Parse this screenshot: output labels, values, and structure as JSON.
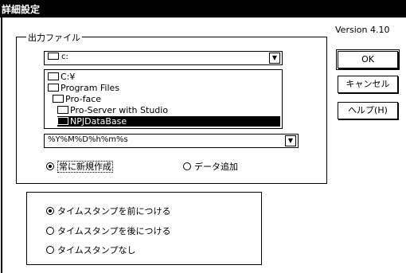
{
  "window": {
    "title": "詳細設定",
    "version": "Version 4.10"
  },
  "output_file": {
    "group_title": "出力ファイル",
    "drive": "c:",
    "folders": [
      {
        "label": "C:¥",
        "selected": false
      },
      {
        "label": "Program Files",
        "selected": false
      },
      {
        "label": "Pro-face",
        "selected": false
      },
      {
        "label": "Pro-Server with Studio",
        "selected": false
      },
      {
        "label": "NPJDataBase",
        "selected": true
      }
    ],
    "filename": "%Y%M%D%h%m%s",
    "options": [
      {
        "label": "常に新規作成",
        "selected": true
      },
      {
        "label": "データ追加",
        "selected": false
      }
    ]
  },
  "timestamp": {
    "options": [
      {
        "label": "タイムスタンプを前につける",
        "selected": true
      },
      {
        "label": "タイムスタンプを後につける",
        "selected": false
      },
      {
        "label": "タイムスタンプなし",
        "selected": false
      }
    ]
  },
  "buttons": {
    "ok": "OK",
    "cancel": "キャンセル",
    "help": "ヘルプ(H)"
  }
}
